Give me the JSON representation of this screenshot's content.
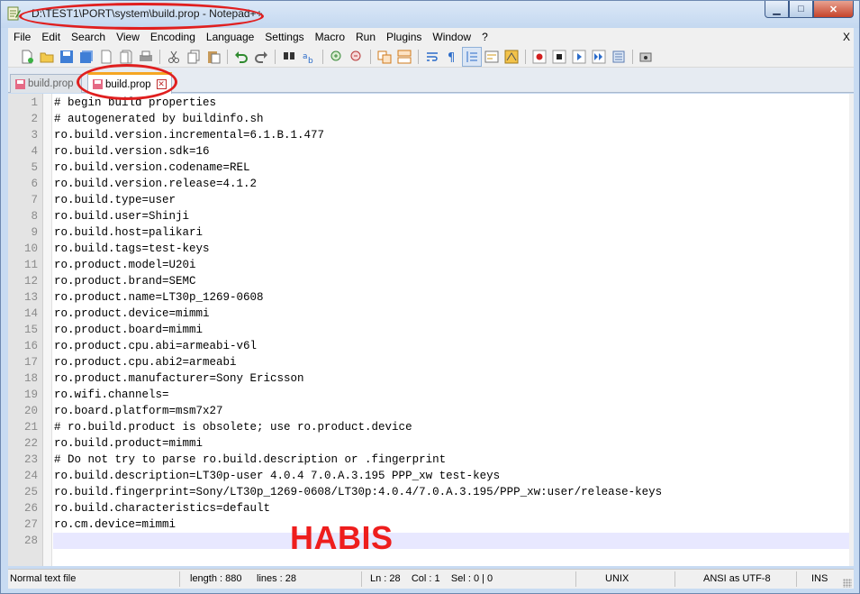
{
  "window": {
    "title": "D:\\TEST1\\PORT\\system\\build.prop - Notepad++",
    "buttons": {
      "minimize": "▁",
      "maximize": "□",
      "close": "✕"
    }
  },
  "menu": {
    "items": [
      "File",
      "Edit",
      "Search",
      "View",
      "Encoding",
      "Language",
      "Settings",
      "Macro",
      "Run",
      "Plugins",
      "Window",
      "?"
    ],
    "close": "X"
  },
  "toolbar": {
    "icons": [
      "new-file-icon",
      "open-file-icon",
      "save-icon",
      "save-all-icon",
      "close-icon",
      "close-all-icon",
      "print-icon",
      "cut-icon",
      "copy-icon",
      "paste-icon",
      "undo-icon",
      "redo-icon",
      "find-icon",
      "replace-icon",
      "zoom-in-icon",
      "zoom-out-icon",
      "sync-vertical-icon",
      "sync-horizontal-icon",
      "word-wrap-icon",
      "show-all-chars-icon",
      "indent-guide-icon",
      "user-lang-icon",
      "doc-map-icon",
      "record-macro-icon",
      "stop-record-icon",
      "play-macro-icon",
      "run-macro-multiple-icon",
      "save-macro-icon",
      "spell-check-icon"
    ]
  },
  "tabs": [
    {
      "label": "build.prop",
      "active": false
    },
    {
      "label": "build.prop",
      "active": true
    }
  ],
  "editor": {
    "lines": [
      "# begin build properties",
      "# autogenerated by buildinfo.sh",
      "ro.build.version.incremental=6.1.B.1.477",
      "ro.build.version.sdk=16",
      "ro.build.version.codename=REL",
      "ro.build.version.release=4.1.2",
      "ro.build.type=user",
      "ro.build.user=Shinji",
      "ro.build.host=palikari",
      "ro.build.tags=test-keys",
      "ro.product.model=U20i",
      "ro.product.brand=SEMC",
      "ro.product.name=LT30p_1269-0608",
      "ro.product.device=mimmi",
      "ro.product.board=mimmi",
      "ro.product.cpu.abi=armeabi-v6l",
      "ro.product.cpu.abi2=armeabi",
      "ro.product.manufacturer=Sony Ericsson",
      "ro.wifi.channels=",
      "ro.board.platform=msm7x27",
      "# ro.build.product is obsolete; use ro.product.device",
      "ro.build.product=mimmi",
      "# Do not try to parse ro.build.description or .fingerprint",
      "ro.build.description=LT30p-user 4.0.4 7.0.A.3.195 PPP_xw test-keys",
      "ro.build.fingerprint=Sony/LT30p_1269-0608/LT30p:4.0.4/7.0.A.3.195/PPP_xw:user/release-keys",
      "ro.build.characteristics=default",
      "ro.cm.device=mimmi",
      ""
    ],
    "current_line": 28,
    "overlay_text": "HABIS"
  },
  "status": {
    "type": "Normal text file",
    "length": "length : 880",
    "lines": "lines : 28",
    "position": "Ln : 28    Col : 1    Sel : 0 | 0",
    "eol": "UNIX",
    "encoding": "ANSI as UTF-8",
    "mode": "INS"
  },
  "colors": {
    "annotation_red": "#e01f1f",
    "tab_accent": "#f5a623",
    "current_line_bg": "#e8e8ff",
    "overlay_text": "#ee1d1d"
  }
}
